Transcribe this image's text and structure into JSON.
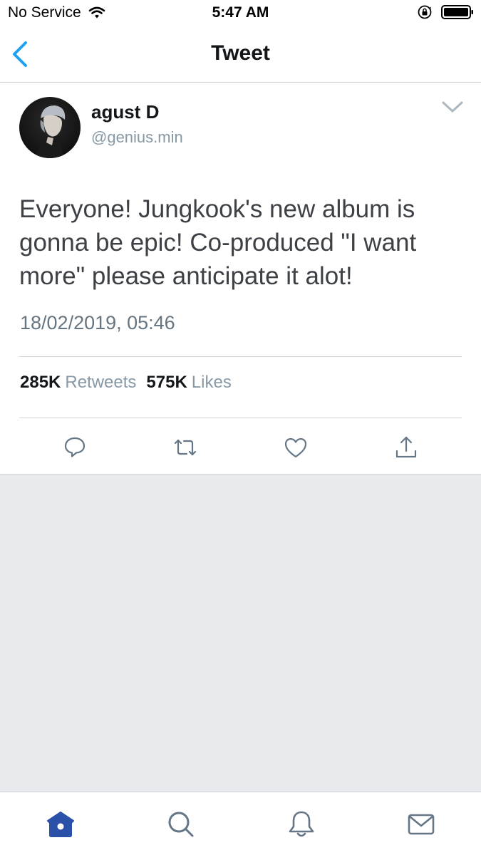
{
  "status_bar": {
    "carrier": "No Service",
    "time": "5:47 AM",
    "icons": [
      "wifi-icon",
      "rotation-lock-icon",
      "battery-icon"
    ]
  },
  "nav": {
    "title": "Tweet",
    "back_icon": "chevron-left-icon"
  },
  "tweet": {
    "display_name": "agust D",
    "handle": "@genius.min",
    "text": "Everyone! Jungkook's new album is gonna be epic! Co-produced \"I want more\" please anticipate it alot!",
    "timestamp": "18/02/2019, 05:46",
    "stats": {
      "retweets_count": "285K",
      "retweets_label": "Retweets",
      "likes_count": "575K",
      "likes_label": "Likes"
    },
    "actions": [
      "reply-icon",
      "retweet-icon",
      "like-icon",
      "share-icon"
    ]
  },
  "tab_bar": {
    "tabs": [
      "home-icon",
      "search-icon",
      "notifications-icon",
      "messages-icon"
    ],
    "active": "home-icon"
  },
  "colors": {
    "accent": "#1da1f2",
    "active_tab": "#2b50a8",
    "secondary_text": "#8899a6",
    "icon_gray": "#657786",
    "background": "#e9eaee"
  }
}
